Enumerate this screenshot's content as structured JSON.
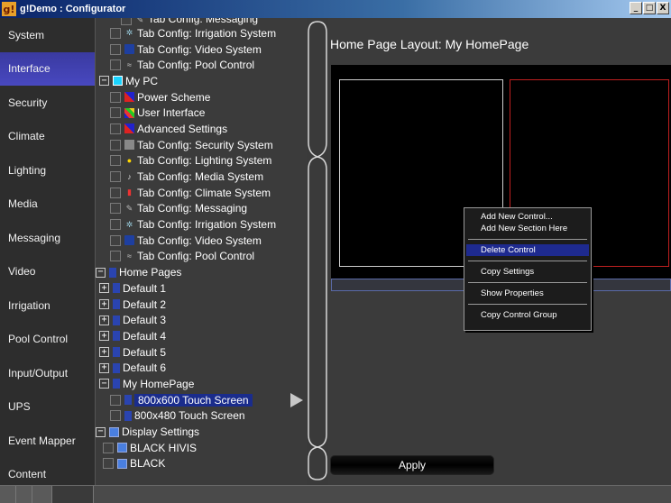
{
  "window": {
    "title": "g!Demo : Configurator",
    "app_icon": "g!",
    "buttons": [
      "_",
      "□",
      "X"
    ]
  },
  "sidebar": {
    "items": [
      {
        "label": "System",
        "active": false
      },
      {
        "label": "Interface",
        "active": true
      },
      {
        "label": "Security",
        "active": false
      },
      {
        "label": "Climate",
        "active": false
      },
      {
        "label": "Lighting",
        "active": false
      },
      {
        "label": "Media",
        "active": false
      },
      {
        "label": "Messaging",
        "active": false
      },
      {
        "label": "Video",
        "active": false
      },
      {
        "label": "Irrigation",
        "active": false
      },
      {
        "label": "Pool Control",
        "active": false
      },
      {
        "label": "Input/Output",
        "active": false
      },
      {
        "label": "UPS",
        "active": false
      },
      {
        "label": "Event Mapper",
        "active": false
      },
      {
        "label": "Content",
        "active": false
      }
    ]
  },
  "tree": {
    "rows": [
      {
        "label": "Tab Config: Messaging",
        "icon": "pen-icon"
      },
      {
        "label": "Tab Config: Irrigation System",
        "icon": "sprinkler-icon"
      },
      {
        "label": "Tab Config: Video System",
        "icon": "video-icon"
      },
      {
        "label": "Tab Config: Pool Control",
        "icon": "pool-icon"
      },
      {
        "label": "My PC",
        "icon": "pc-icon",
        "expander": "−"
      },
      {
        "label": "Power Scheme",
        "icon": "power-scheme-icon"
      },
      {
        "label": "User Interface",
        "icon": "user-interface-icon"
      },
      {
        "label": "Advanced Settings",
        "icon": "advanced-settings-icon"
      },
      {
        "label": "Tab Config: Security System",
        "icon": "security-icon"
      },
      {
        "label": "Tab Config: Lighting System",
        "icon": "bulb-icon"
      },
      {
        "label": "Tab Config: Media System",
        "icon": "note-icon"
      },
      {
        "label": "Tab Config: Climate System",
        "icon": "thermometer-icon"
      },
      {
        "label": "Tab Config: Messaging",
        "icon": "pen-icon"
      },
      {
        "label": "Tab Config: Irrigation System",
        "icon": "sprinkler-icon"
      },
      {
        "label": "Tab Config: Video System",
        "icon": "video-icon"
      },
      {
        "label": "Tab Config: Pool Control",
        "icon": "pool-icon"
      },
      {
        "label": "Home Pages",
        "icon": "home-page-icon",
        "expander": "−"
      },
      {
        "label": "Default 1",
        "icon": "home-page-icon",
        "expander": "+"
      },
      {
        "label": "Default 2",
        "icon": "home-page-icon",
        "expander": "+"
      },
      {
        "label": "Default 3",
        "icon": "home-page-icon",
        "expander": "+"
      },
      {
        "label": "Default 4",
        "icon": "home-page-icon",
        "expander": "+"
      },
      {
        "label": "Default 5",
        "icon": "home-page-icon",
        "expander": "+"
      },
      {
        "label": "Default 6",
        "icon": "home-page-icon",
        "expander": "+"
      },
      {
        "label": "My HomePage",
        "icon": "home-page-icon",
        "expander": "−"
      },
      {
        "label": "800x600 Touch Screen",
        "icon": "home-page-icon",
        "selected": true
      },
      {
        "label": "800x480 Touch Screen",
        "icon": "home-page-icon"
      },
      {
        "label": "Display Settings",
        "icon": "display-icon",
        "expander": "−"
      },
      {
        "label": "BLACK HIVIS",
        "icon": "display-icon"
      },
      {
        "label": "BLACK",
        "icon": "display-icon"
      }
    ]
  },
  "content": {
    "page_title": "Home Page Layout: My HomePage",
    "apply_label": "Apply"
  },
  "context_menu": {
    "items": [
      {
        "label": "Add New Control..."
      },
      {
        "label": "Add New Section Here"
      },
      {
        "separator": true
      },
      {
        "label": "Delete Control",
        "highlighted": true
      },
      {
        "separator": true
      },
      {
        "label": "Copy Settings"
      },
      {
        "separator": true
      },
      {
        "label": "Show Properties"
      },
      {
        "separator": true
      },
      {
        "label": "Copy Control Group"
      }
    ]
  },
  "colors": {
    "active_nav": "#3a3aa0",
    "selection": "#1a2c8c",
    "section_red": "#c02020",
    "background": "#3b3b3b"
  }
}
